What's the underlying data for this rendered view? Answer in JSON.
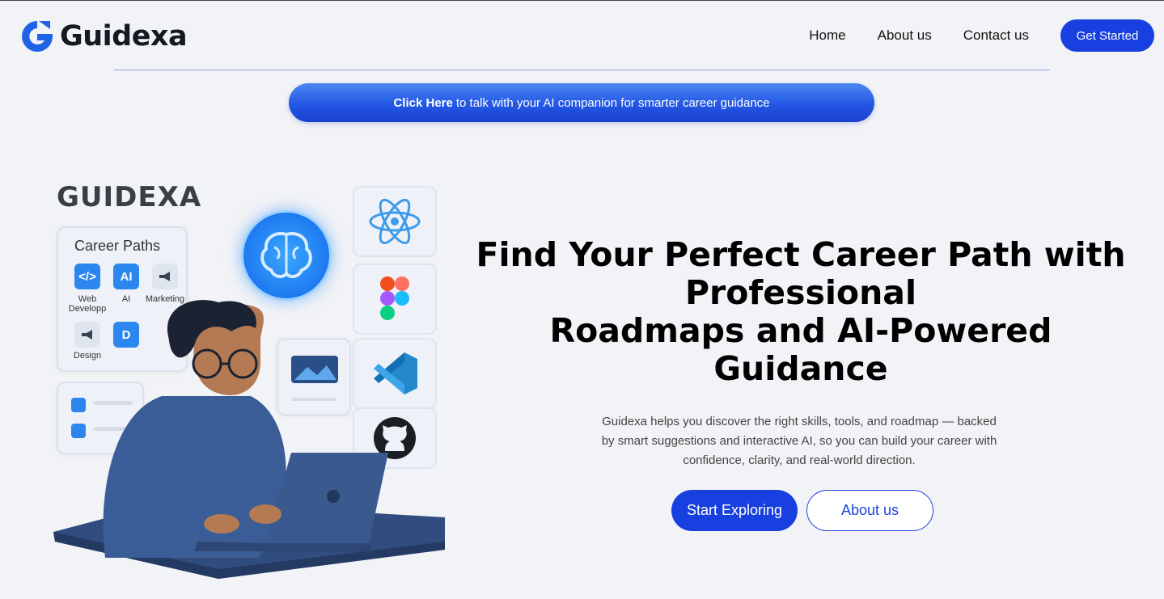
{
  "header": {
    "brand": "Guidexa",
    "nav": [
      {
        "label": "Home"
      },
      {
        "label": "About us"
      },
      {
        "label": "Contact us"
      }
    ],
    "cta_label": "Get Started"
  },
  "banner": {
    "link_text": "Click Here",
    "rest_text": "to talk with your AI companion for smarter career guidance"
  },
  "illustration": {
    "brand_word": "GUIDEXA",
    "card_title": "Career Paths",
    "chips": [
      {
        "glyph": "</>",
        "label": "Web Developp",
        "icon": "code-icon"
      },
      {
        "glyph": "AI",
        "label": "AI",
        "icon": "ai-icon"
      },
      {
        "glyph": "",
        "label": "Marketing",
        "icon": "megaphone-icon"
      },
      {
        "glyph": "",
        "label": "Design",
        "icon": "megaphone-icon"
      },
      {
        "glyph": "D",
        "label": "",
        "icon": "d-icon"
      }
    ],
    "tiles": [
      "react-icon",
      "figma-icon",
      "vscode-icon",
      "github-icon"
    ]
  },
  "hero": {
    "title_line1": "Find Your Perfect Career Path with Professional",
    "title_line2": "Roadmaps and AI-Powered Guidance",
    "subtitle": "Guidexa helps you discover the right skills, tools, and roadmap — backed by smart suggestions and interactive AI, so you can build your career with confidence, clarity, and real-world direction.",
    "primary_button": "Start Exploring",
    "secondary_button": "About us"
  },
  "colors": {
    "brand_blue": "#1840e0",
    "background": "#f2f3f6",
    "banner_blue": "#2357e4"
  }
}
